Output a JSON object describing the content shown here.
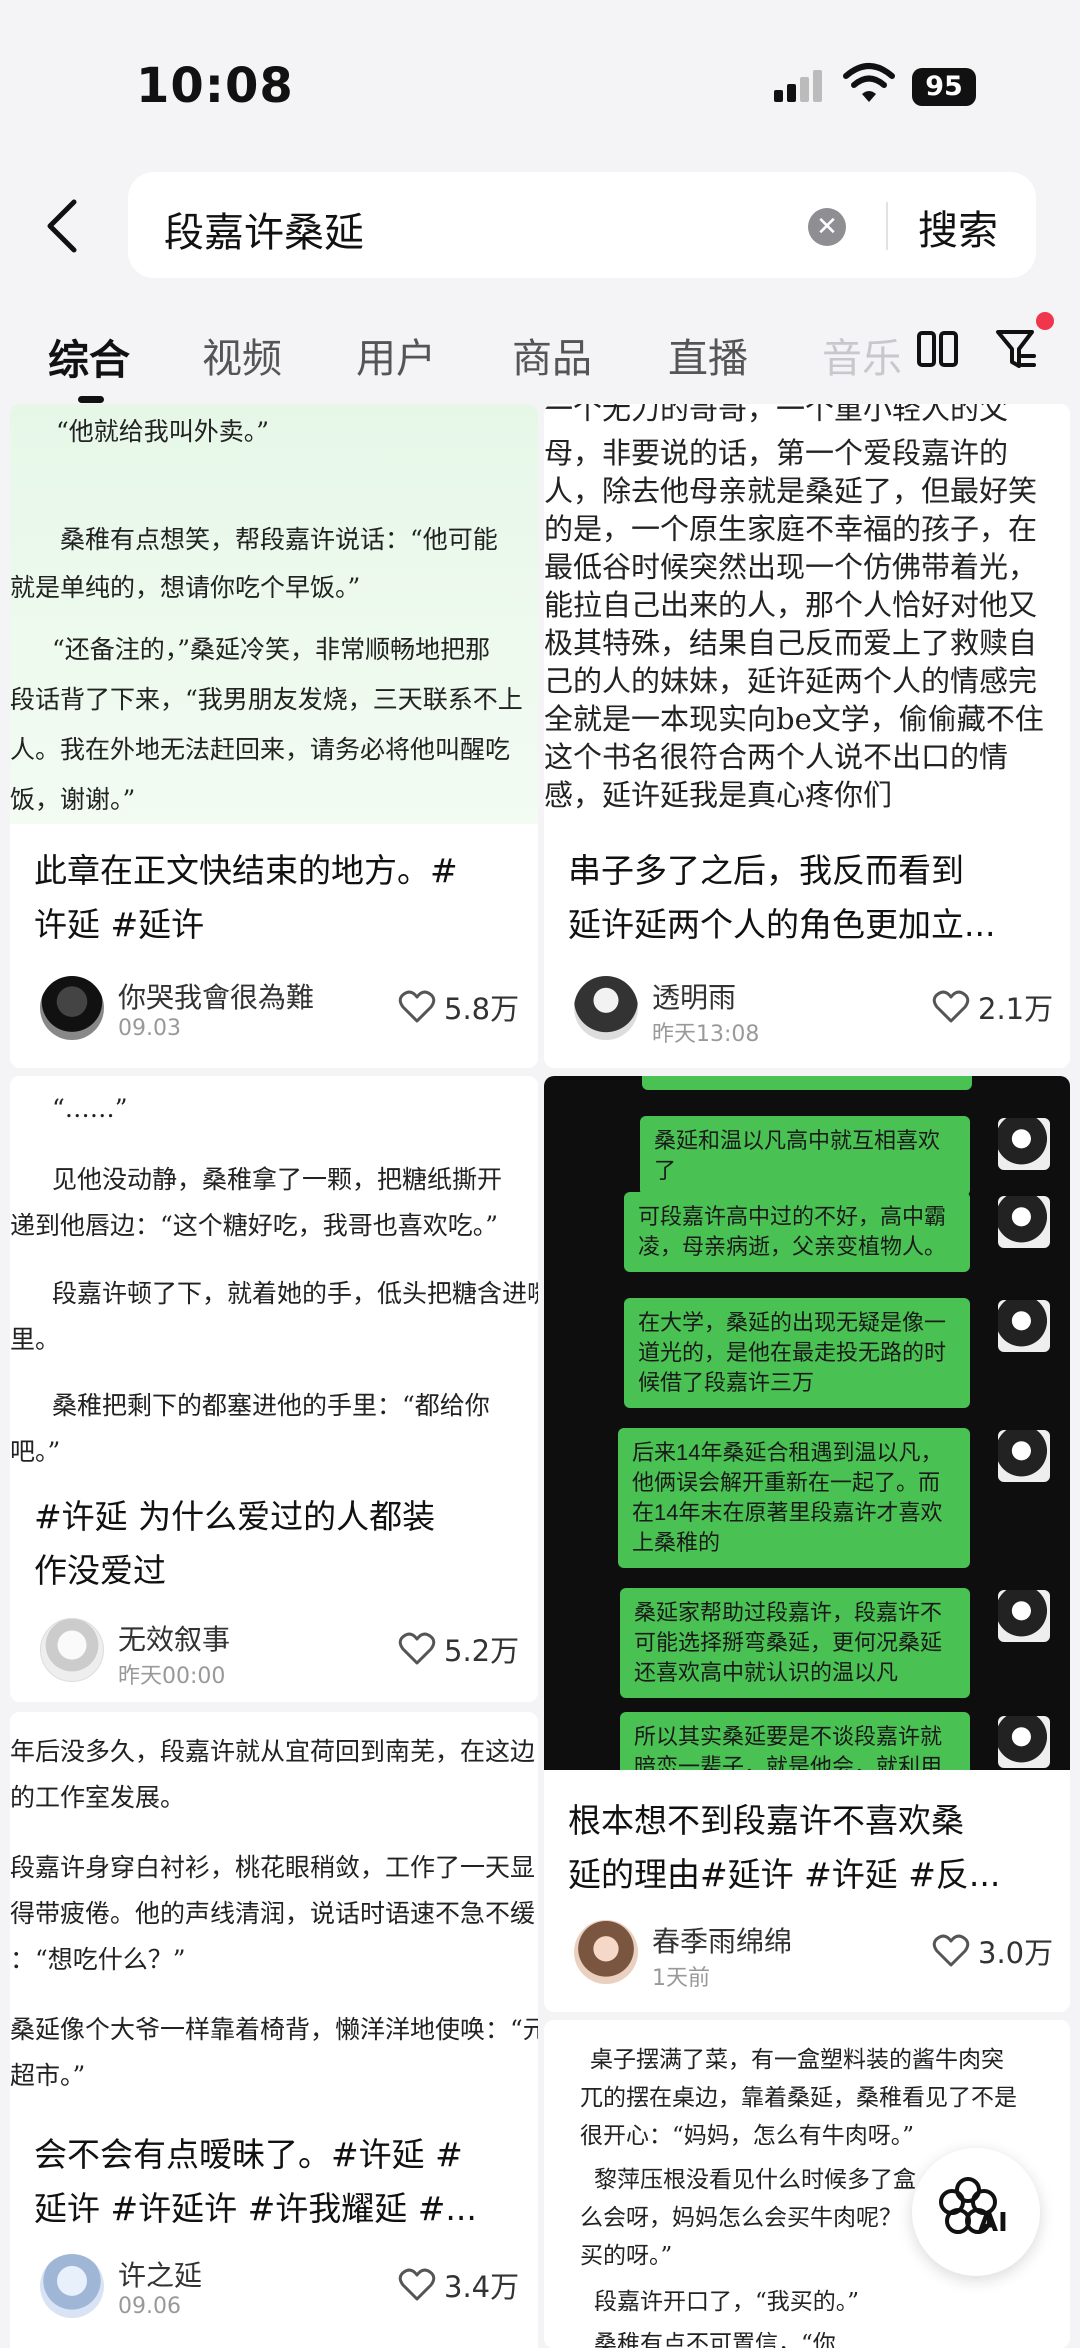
{
  "status_bar": {
    "time": "10:08",
    "battery": "95"
  },
  "search": {
    "query": "段嘉许桑延",
    "button": "搜索"
  },
  "tabs": [
    "综合",
    "视频",
    "用户",
    "商品",
    "直播",
    "音乐"
  ],
  "cards": [
    {
      "thumb_lines": [
        "“他就给我叫外卖。”",
        "桑稚有点想笑，帮段嘉许说话：“他可能",
        "就是单纯的，想请你吃个早饭。”",
        "“还备注的，”桑延冷笑，非常顺畅地把那",
        "段话背了下来，“我男朋友发烧，三天联系不上",
        "人。我在外地无法赶回来，请务必将他叫醒吃",
        "饭，谢谢。”"
      ],
      "caption_lines": [
        "此章在正文快结束的地方。#",
        "许延 #延许"
      ],
      "author": "你哭我會很為難",
      "date": "09.03",
      "likes": "5.8万"
    },
    {
      "thumb_lines": [
        "一个无力的哥哥，一个重小轻人的父",
        "母，非要说的话，第一个爱段嘉许的",
        "人，除去他母亲就是桑延了，但最好笑",
        "的是，一个原生家庭不幸福的孩子，在",
        "最低谷时候突然出现一个仿佛带着光，",
        "能拉自己出来的人，那个人恰好对他又",
        "极其特殊，结果自己反而爱上了救赎自",
        "己的人的妹妹，延许延两个人的情感完",
        "全就是一本现实向be文学，偷偷藏不住",
        "这个书名很符合两个人说不出口的情",
        "感，延许延我是真心疼你们"
      ],
      "caption_lines": [
        "串子多了之后，我反而看到",
        "延许延两个人的角色更加立..."
      ],
      "author": "透明雨",
      "date": "昨天13:08",
      "likes": "2.1万"
    },
    {
      "thumb_lines": [
        "“……”",
        "见他没动静，桑稚拿了一颗，把糖纸撕开",
        "递到他唇边：“这个糖好吃，我哥也喜欢吃。”",
        "段嘉许顿了下，就着她的手，低头把糖含进嘴",
        "里。",
        "桑稚把剩下的都塞进他的手里：“都给你",
        "吧。”"
      ],
      "caption_lines": [
        "#许延 为什么爱过的人都装",
        "作没爱过"
      ],
      "author": "无效叙事",
      "date": "昨天00:00",
      "likes": "5.2万"
    },
    {
      "chat_bubbles": [
        "桑延和温以凡高中就互相喜欢了",
        "可段嘉许高中过的不好，高中霸凌，母亲病逝，父亲变植物人。",
        "在大学，桑延的出现无疑是像一道光的，是他在最走投无路的时候借了段嘉许三万",
        "后来14年桑延合租遇到温以凡，他俩误会解开重新在一起了。而在14年末在原著里段嘉许才喜欢上桑稚的",
        "桑延家帮助过段嘉许，段嘉许不可能选择掰弯桑延，更何况桑延还喜欢高中就认识的温以凡",
        "所以其实桑延要是不谈段嘉许就暗恋一辈子，就是他会，就利用桑"
      ],
      "caption_lines": [
        "根本想不到段嘉许不喜欢桑",
        "延的理由#延许 #许延 #反..."
      ],
      "author": "春季雨绵绵",
      "date": "1天前",
      "likes": "3.0万"
    },
    {
      "thumb_lines": [
        "年后没多久，段嘉许就从宜荷回到南芜，在这边",
        "的工作室发展。",
        "段嘉许身穿白衬衫，桃花眼稍敛，工作了一天显",
        "得带疲倦。他的声线清润，说话时语速不急不缓",
        "：“想吃什么？”",
        "桑延像个大爷一样靠着椅背，懒洋洋地使唤：“元",
        "超市。”"
      ],
      "caption_lines": [
        "会不会有点暧昧了。#许延 #",
        "延许 #许延许 #许我耀延 #..."
      ],
      "author": "许之延",
      "date": "09.06",
      "likes": "3.4万"
    },
    {
      "thumb_lines": [
        "桌子摆满了菜，有一盒塑料装的酱牛肉突",
        "兀的摆在桌边，靠着桑延，桑稚看见了不是",
        "很开心：“妈妈，怎么有牛肉呀。”",
        "黎萍压根没看见什么时候多了盒",
        "么会呀，妈妈怎么会买牛肉呢？",
        "买的呀。”",
        "段嘉许开口了，“我买的。”",
        "桑稚有点不可置信，“你"
      ]
    }
  ],
  "ai_button": "AI",
  "colors": {
    "accent_red": "#f0354d",
    "chat_green": "#49c253",
    "card_bg": "#ffffff",
    "page_bg": "#f4f4f6"
  }
}
